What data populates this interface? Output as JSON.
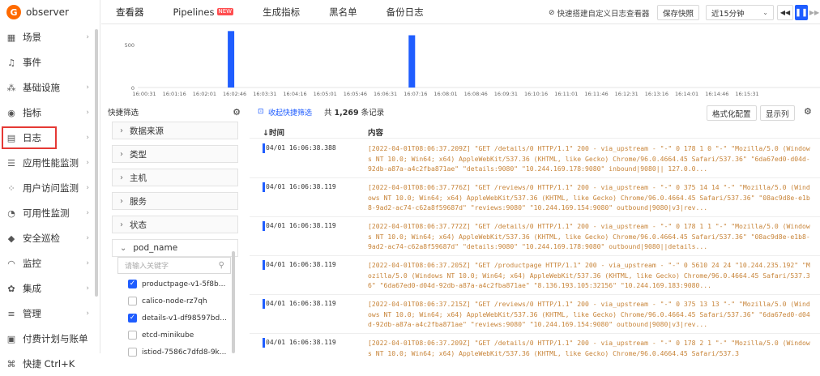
{
  "app": {
    "name": "observer"
  },
  "sidebar": {
    "items": [
      {
        "label": "场景",
        "icon": "scene-icon",
        "arrow": true
      },
      {
        "label": "事件",
        "icon": "bell-icon",
        "arrow": false
      },
      {
        "label": "基础设施",
        "icon": "infra-icon",
        "arrow": true
      },
      {
        "label": "指标",
        "icon": "metrics-icon",
        "arrow": true
      },
      {
        "label": "日志",
        "icon": "log-icon",
        "arrow": true,
        "active": true
      },
      {
        "label": "应用性能监测",
        "icon": "apm-icon",
        "arrow": true
      },
      {
        "label": "用户访问监测",
        "icon": "rum-icon",
        "arrow": true
      },
      {
        "label": "可用性监测",
        "icon": "availability-icon",
        "arrow": true
      },
      {
        "label": "安全巡检",
        "icon": "shield-icon",
        "arrow": true
      },
      {
        "label": "监控",
        "icon": "monitor-icon",
        "arrow": true
      },
      {
        "label": "集成",
        "icon": "integration-icon",
        "arrow": true
      },
      {
        "label": "管理",
        "icon": "manage-icon",
        "arrow": true
      },
      {
        "label": "付费计划与账单",
        "icon": "billing-icon",
        "arrow": false
      },
      {
        "label": "快捷 Ctrl+K",
        "icon": "shortcut-icon",
        "arrow": false
      }
    ]
  },
  "topbar": {
    "tabs": [
      {
        "label": "查看器"
      },
      {
        "label": "Pipelines",
        "badge": "NEW"
      },
      {
        "label": "生成指标"
      },
      {
        "label": "黑名单"
      },
      {
        "label": "备份日志"
      }
    ],
    "quick_build": "快速搭建自定义日志查看器",
    "save_snapshot": "保存快照",
    "time_range": "近15分钟",
    "rewind_icon": "rewind-icon",
    "pause_icon": "pause-icon",
    "forward_icon": "forward-icon"
  },
  "chart_data": {
    "type": "bar",
    "categories": [
      "16:00:31",
      "16:01:16",
      "16:02:01",
      "16:02:46",
      "16:03:31",
      "16:04:16",
      "16:05:01",
      "16:05:46",
      "16:06:31",
      "16:07:16",
      "16:08:01",
      "16:08:46",
      "16:09:31",
      "16:10:16",
      "16:11:01",
      "16:11:46",
      "16:12:31",
      "16:13:16",
      "16:14:01",
      "16:14:46",
      "16:15:31"
    ],
    "series": [
      {
        "values": [
          0,
          0,
          659,
          0,
          0,
          0,
          0,
          0,
          610,
          0,
          0,
          0,
          0,
          0,
          0,
          0,
          0,
          0,
          0,
          0,
          0
        ]
      }
    ],
    "yticks": [
      "0",
      "500"
    ],
    "ylim": [
      0,
      700
    ],
    "color": "#1f5dff"
  },
  "quick_filter": {
    "title": "快捷筛选",
    "gear_icon": "gear-icon",
    "groups": [
      {
        "label": "数据来源",
        "open": false
      },
      {
        "label": "类型",
        "open": false
      },
      {
        "label": "主机",
        "open": false
      },
      {
        "label": "服务",
        "open": false
      },
      {
        "label": "状态",
        "open": false
      },
      {
        "label": "pod_name",
        "open": true
      }
    ],
    "search_placeholder": "请输入关键字",
    "options": [
      {
        "label": "productpage-v1-5f8b...",
        "checked": true
      },
      {
        "label": "calico-node-rz7qh",
        "checked": false
      },
      {
        "label": "details-v1-df98597bd...",
        "checked": true
      },
      {
        "label": "etcd-minikube",
        "checked": false
      },
      {
        "label": "istiod-7586c7dfd8-9k...",
        "checked": false
      }
    ]
  },
  "logs": {
    "collapse_label": "收起快捷筛选",
    "total_prefix": "共",
    "total_count": "1,269",
    "total_suffix": "条记录",
    "format_btn": "格式化配置",
    "columns_btn": "显示列",
    "settings_icon": "settings-icon",
    "col_time": "↓时间",
    "col_content": "内容",
    "rows": [
      {
        "time": "04/01 16:06:38.388",
        "content": "[2022-04-01T08:06:37.209Z] \"GET /details/0 HTTP/1.1\" 200 - via_upstream - \"-\" 0 178 1 0 \"-\" \"Mozilla/5.0 (Windows NT 10.0; Win64; x64) AppleWebKit/537.36 (KHTML, like Gecko) Chrome/96.0.4664.45 Safari/537.36\" \"6da67ed0-d04d-92db-a87a-a4c2fba871ae\" \"details:9080\" \"10.244.169.178:9080\" inbound|9080|| 127.0.0..."
      },
      {
        "time": "04/01 16:06:38.119",
        "content": "[2022-04-01T08:06:37.776Z] \"GET /reviews/0 HTTP/1.1\" 200 - via_upstream - \"-\" 0 375 14 14 \"-\" \"Mozilla/5.0 (Windows NT 10.0; Win64; x64) AppleWebKit/537.36 (KHTML, like Gecko) Chrome/96.0.4664.45 Safari/537.36\" \"08ac9d8e-e1b8-9ad2-ac74-c62a8f59687d\" \"reviews:9080\" \"10.244.169.154:9080\" outbound|9080|v3|rev..."
      },
      {
        "time": "04/01 16:06:38.119",
        "content": "[2022-04-01T08:06:37.772Z] \"GET /details/0 HTTP/1.1\" 200 - via_upstream - \"-\" 0 178 1 1 \"-\" \"Mozilla/5.0 (Windows NT 10.0; Win64; x64) AppleWebKit/537.36 (KHTML, like Gecko) Chrome/96.0.4664.45 Safari/537.36\" \"08ac9d8e-e1b8-9ad2-ac74-c62a8f59687d\" \"details:9080\" \"10.244.169.178:9080\" outbound|9080||details..."
      },
      {
        "time": "04/01 16:06:38.119",
        "content": "[2022-04-01T08:06:37.205Z] \"GET /productpage HTTP/1.1\" 200 - via_upstream - \"-\" 0 5610 24 24 \"10.244.235.192\" \"Mozilla/5.0 (Windows NT 10.0; Win64; x64) AppleWebKit/537.36 (KHTML, like Gecko) Chrome/96.0.4664.45 Safari/537.36\" \"6da67ed0-d04d-92db-a87a-a4c2fba871ae\" \"8.136.193.105:32156\" \"10.244.169.183:9080..."
      },
      {
        "time": "04/01 16:06:38.119",
        "content": "[2022-04-01T08:06:37.215Z] \"GET /reviews/0 HTTP/1.1\" 200 - via_upstream - \"-\" 0 375 13 13 \"-\" \"Mozilla/5.0 (Windows NT 10.0; Win64; x64) AppleWebKit/537.36 (KHTML, like Gecko) Chrome/96.0.4664.45 Safari/537.36\" \"6da67ed0-d04d-92db-a87a-a4c2fba871ae\" \"reviews:9080\" \"10.244.169.154:9080\" outbound|9080|v3|rev..."
      },
      {
        "time": "04/01 16:06:38.119",
        "content": "[2022-04-01T08:06:37.209Z] \"GET /details/0 HTTP/1.1\" 200 - via_upstream - \"-\" 0 178 2 1 \"-\" \"Mozilla/5.0 (Windows NT 10.0; Win64; x64) AppleWebKit/537.36 (KHTML, like Gecko) Chrome/96.0.4664.45 Safari/537.3"
      }
    ]
  }
}
